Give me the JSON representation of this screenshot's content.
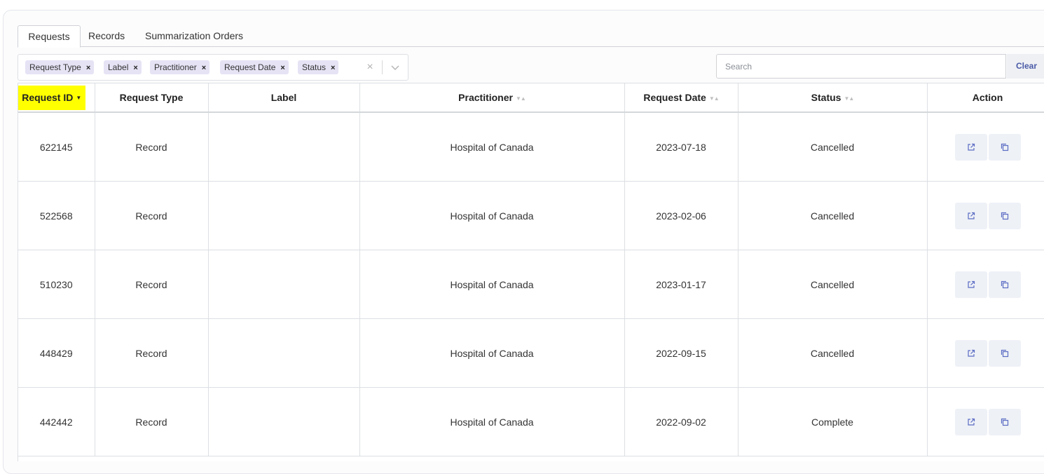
{
  "tabs": [
    {
      "label": "Requests",
      "active": true
    },
    {
      "label": "Records",
      "active": false
    },
    {
      "label": "Summarization Orders",
      "active": false
    }
  ],
  "filter": {
    "chips": [
      {
        "label": "Request Type",
        "remove": "×"
      },
      {
        "label": "Label",
        "remove": "×"
      },
      {
        "label": "Practitioner",
        "remove": "×"
      },
      {
        "label": "Request Date",
        "remove": "×"
      },
      {
        "label": "Status",
        "remove": "×"
      }
    ],
    "clear_all_icon": "x-icon",
    "dropdown_icon": "chevron-down-icon"
  },
  "search": {
    "placeholder": "Search",
    "value": "",
    "clear_label": "Clear"
  },
  "table": {
    "columns": [
      {
        "label": "Request ID",
        "sort": "descending",
        "highlighted": true
      },
      {
        "label": "Request Type",
        "sort": "none"
      },
      {
        "label": "Label",
        "sort": "none"
      },
      {
        "label": "Practitioner",
        "sort": "sortable"
      },
      {
        "label": "Request Date",
        "sort": "sortable"
      },
      {
        "label": "Status",
        "sort": "sortable"
      },
      {
        "label": "Action",
        "sort": "none"
      }
    ],
    "rows": [
      {
        "id": "622145",
        "type": "Record",
        "label": "",
        "practitioner": "Hospital of Canada",
        "date": "2023-07-18",
        "status": "Cancelled"
      },
      {
        "id": "522568",
        "type": "Record",
        "label": "",
        "practitioner": "Hospital of Canada",
        "date": "2023-02-06",
        "status": "Cancelled"
      },
      {
        "id": "510230",
        "type": "Record",
        "label": "",
        "practitioner": "Hospital of Canada",
        "date": "2023-01-17",
        "status": "Cancelled"
      },
      {
        "id": "448429",
        "type": "Record",
        "label": "",
        "practitioner": "Hospital of Canada",
        "date": "2022-09-15",
        "status": "Cancelled"
      },
      {
        "id": "442442",
        "type": "Record",
        "label": "",
        "practitioner": "Hospital of Canada",
        "date": "2022-09-02",
        "status": "Complete"
      }
    ],
    "action_icons": [
      "external-link-icon",
      "copy-icon"
    ]
  },
  "colors": {
    "highlight": "#ffff00",
    "chip_bg": "#e6e3f5",
    "clear_text": "#4a5aa8",
    "action_bg": "#eef1f6",
    "icon_color": "#5b6cc4"
  }
}
